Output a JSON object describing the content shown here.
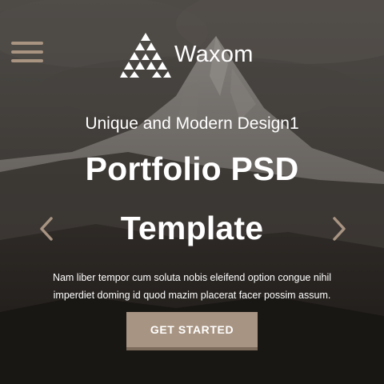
{
  "header": {
    "menu_icon": "hamburger-menu-icon",
    "logo_icon": "triangle-mountain-logo-icon",
    "brand_name": "Waxom"
  },
  "hero": {
    "subtitle": "Unique and Modern Design1",
    "title_line1": "Portfolio PSD",
    "title_line2": "Template",
    "description_line1": "Nam liber tempor cum soluta nobis eleifend option congue nihil",
    "description_line2": "imperdiet doming id quod mazim placerat facer possim assum.",
    "cta_label": "GET STARTED",
    "prev_icon": "chevron-left-icon",
    "next_icon": "chevron-right-icon"
  },
  "colors": {
    "accent": "#a89482",
    "accent_dark": "#7d6b5c",
    "text": "#ffffff",
    "background": "#3a3734"
  }
}
